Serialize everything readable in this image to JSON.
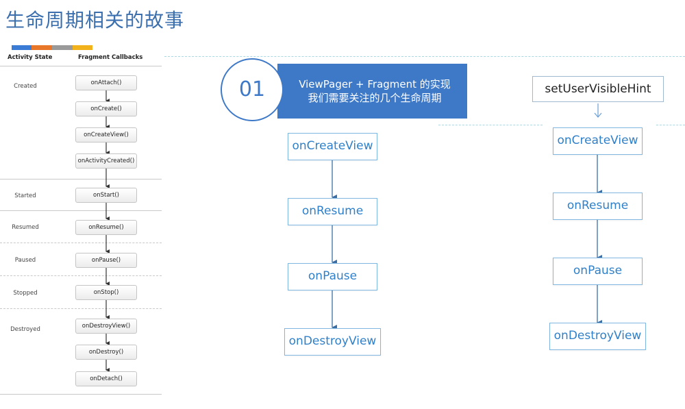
{
  "title": "生命周期相关的故事",
  "lifecycle": {
    "col_headers": {
      "state": "Activity State",
      "callbacks": "Fragment Callbacks"
    },
    "color_bar": [
      "#3a7bd5",
      "#e9772a",
      "#9a9a9a",
      "#f2b21b"
    ],
    "states": [
      "Created",
      "Started",
      "Resumed",
      "Paused",
      "Stopped",
      "Destroyed"
    ],
    "callbacks": [
      "onAttach()",
      "onCreate()",
      "onCreateView()",
      "onActivityCreated()",
      "onStart()",
      "onResume()",
      "onPause()",
      "onStop()",
      "onDestroyView()",
      "onDestroy()",
      "onDetach()"
    ]
  },
  "badge": {
    "number": "01",
    "line1": "ViewPager + Fragment 的实现",
    "line2": "我们需要关注的几个生命周期"
  },
  "flow_left": [
    "onCreateView",
    "onResume",
    "onPause",
    "onDestroyView"
  ],
  "flow_right": {
    "trigger": "setUserVisibleHint",
    "steps": [
      "onCreateView",
      "onResume",
      "onPause",
      "onDestroyView"
    ]
  },
  "colors": {
    "title": "#3b6fae",
    "accent": "#3e79c8",
    "flow_text": "#2f80c9",
    "flow_border": "#7fb7e0"
  }
}
